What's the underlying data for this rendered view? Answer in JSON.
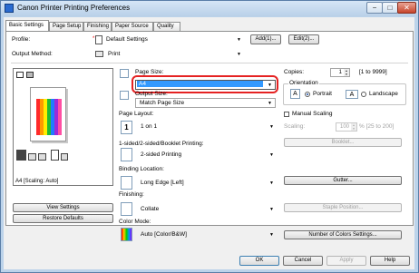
{
  "window": {
    "title": "Canon Printer Printing Preferences"
  },
  "tabs": [
    "Basic Settings",
    "Page Setup",
    "Finishing",
    "Paper Source",
    "Quality"
  ],
  "profile": {
    "label": "Profile:",
    "value": "Default Settings",
    "add": "Add(1)...",
    "edit": "Edit(2)..."
  },
  "output_method": {
    "label": "Output Method:",
    "value": "Print"
  },
  "preview": {
    "caption": "A4 [Scaling: Auto]",
    "view_settings": "View Settings",
    "restore_defaults": "Restore Defaults"
  },
  "page_size": {
    "label": "Page Size:",
    "value": "A4"
  },
  "output_size": {
    "label": "Output Size:",
    "value": "Match Page Size"
  },
  "copies": {
    "label": "Copies:",
    "value": "1",
    "range": "[1 to 9999]"
  },
  "orientation": {
    "label": "Orientation",
    "portrait": "Portrait",
    "landscape": "Landscape"
  },
  "manual_scaling": {
    "label": "Manual Scaling",
    "scaling_label": "Scaling:",
    "value": "100",
    "range": "% [25 to 200]"
  },
  "page_layout": {
    "label": "Page Layout:",
    "value": "1 on 1"
  },
  "print_mode": {
    "label": "1-sided/2-sided/Booklet Printing:",
    "value": "2-sided Printing",
    "booklet_button": "Booklet..."
  },
  "binding": {
    "label": "Binding Location:",
    "value": "Long Edge [Left]",
    "gutter_button": "Gutter..."
  },
  "finishing": {
    "label": "Finishing:",
    "value": "Collate",
    "staple_button": "Staple Position..."
  },
  "color_mode": {
    "label": "Color Mode:",
    "value": "Auto [Color/B&W]",
    "colors_button": "Number of Colors Settings..."
  },
  "footer": {
    "ok": "OK",
    "cancel": "Cancel",
    "apply": "Apply",
    "help": "Help"
  },
  "colors": {
    "title_bg": "#c7dcf1",
    "highlight": "#e52222",
    "selection": "#3399ff"
  }
}
